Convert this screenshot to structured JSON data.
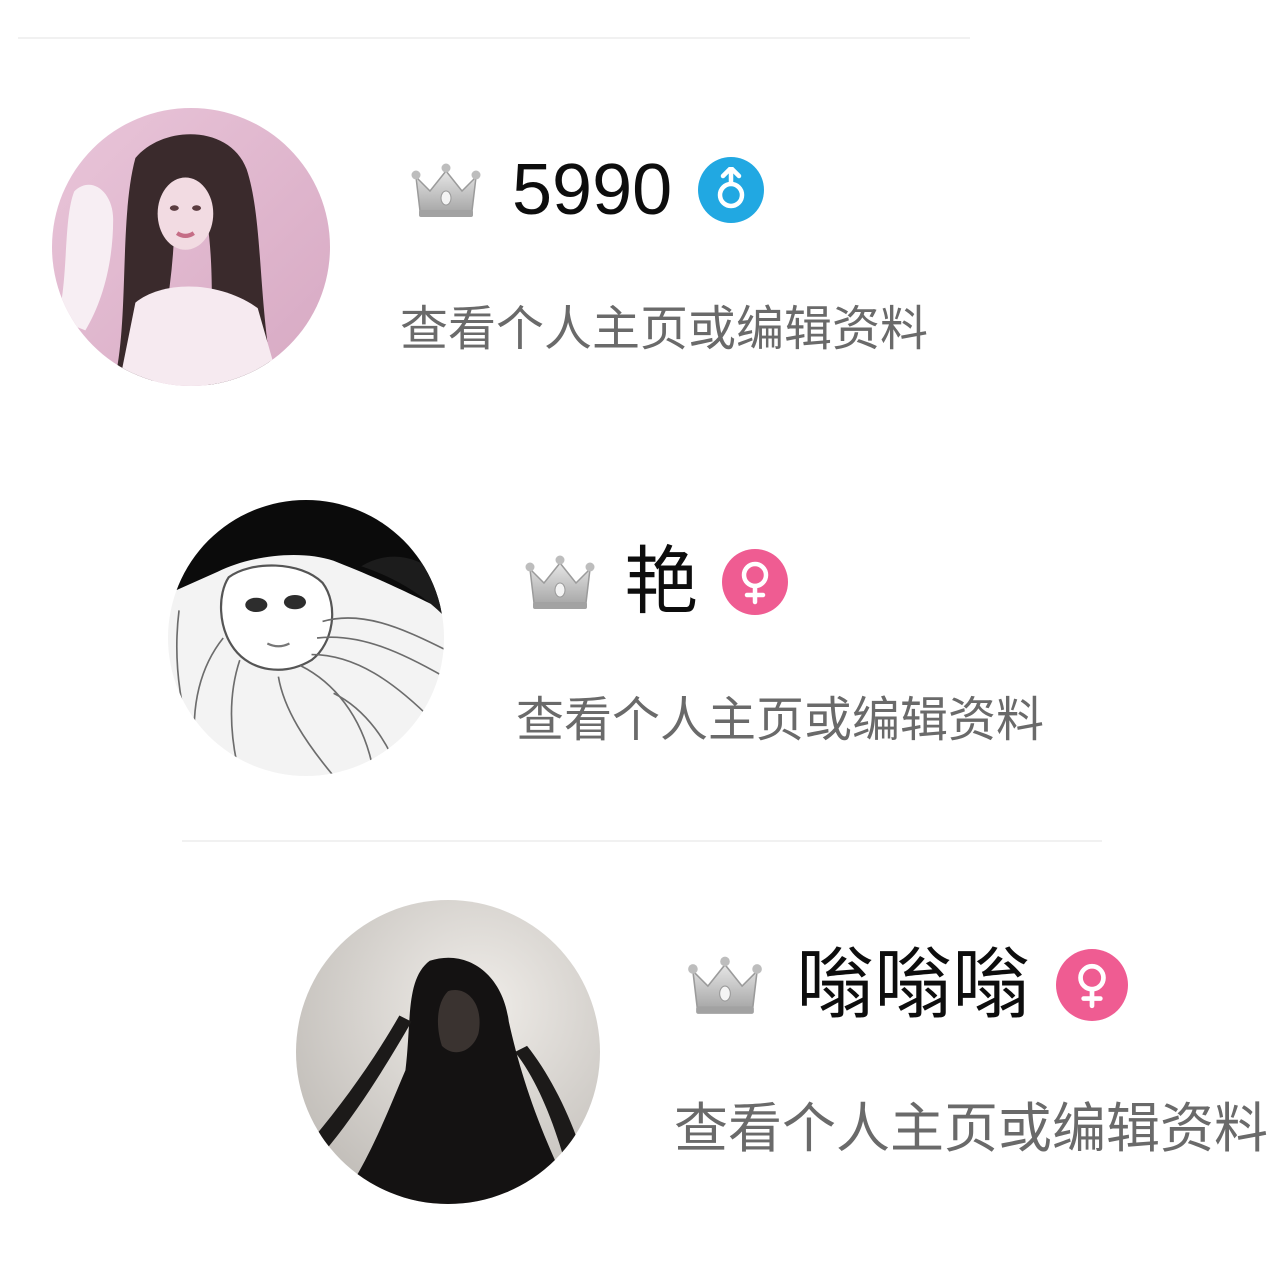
{
  "profiles": [
    {
      "name": "5990",
      "gender": "male",
      "gender_color": "#21a8e2",
      "badge_icon": "crown-icon",
      "subtitle": "查看个人主页或编辑资料",
      "avatar_icon": "avatar-photo-pink"
    },
    {
      "name": "艳",
      "gender": "female",
      "gender_color": "#ef5c92",
      "badge_icon": "crown-icon",
      "subtitle": "查看个人主页或编辑资料",
      "avatar_icon": "avatar-sketch-girl"
    },
    {
      "name": "嗡嗡嗡",
      "gender": "female",
      "gender_color": "#ef5c92",
      "badge_icon": "crown-icon",
      "subtitle": "查看个人主页或编辑资料",
      "avatar_icon": "avatar-photo-dark"
    }
  ]
}
